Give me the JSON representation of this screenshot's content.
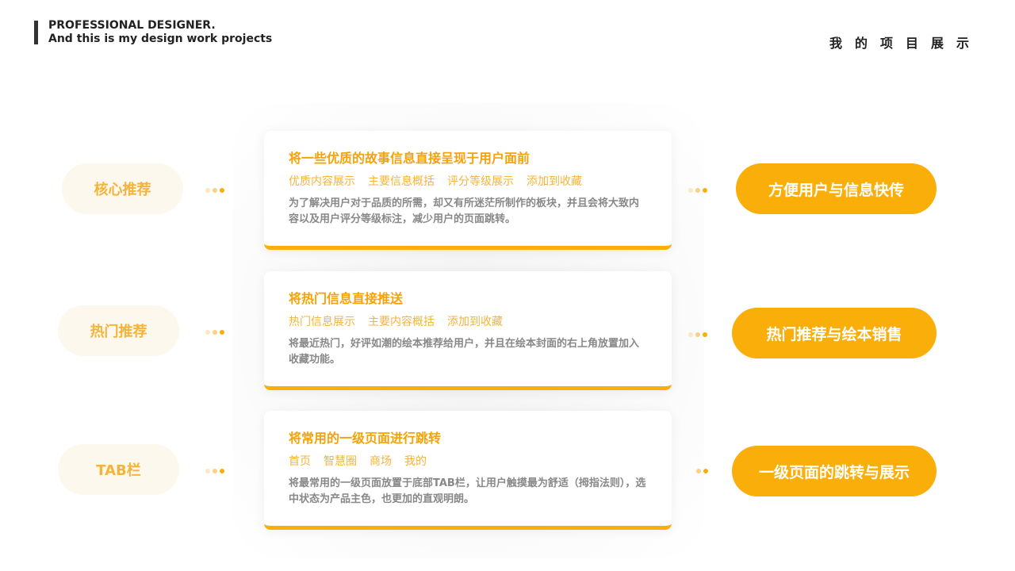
{
  "header": {
    "line1": "PROFESSIONAL DESIGNER.",
    "line2": "And this is my design work projects",
    "right_title": "我的项目展示"
  },
  "rows": [
    {
      "left_label": "核心推荐",
      "card_title": "将一些优质的故事信息直接呈现于用户面前",
      "tags": [
        "优质内容展示",
        "主要信息概括",
        "评分等级展示",
        "添加到收藏"
      ],
      "description": "为了解决用户对于品质的所需，却又有所迷茫所制作的板块，并且会将大致内容以及用户评分等级标注，减少用户的页面跳转。",
      "right_label": "方便用户与信息快传"
    },
    {
      "left_label": "热门推荐",
      "card_title": "将热门信息直接推送",
      "tags": [
        "热门信息展示",
        "主要内容概括",
        "添加到收藏"
      ],
      "description": "将最近热门，好评如潮的绘本推荐给用户，并且在绘本封面的右上角放置加入收藏功能。",
      "right_label": "热门推荐与绘本销售"
    },
    {
      "left_label": "TAB栏",
      "card_title": "将常用的一级页面进行跳转",
      "tags": [
        "首页",
        "智慧圈",
        "商场",
        "我的"
      ],
      "description": "将最常用的一级页面放置于底部TAB栏，让用户触摸最为舒适（拇指法则），选中状态为产品主色，也更加的直观明朗。",
      "right_label": "一级页面的跳转与展示"
    }
  ],
  "colors": {
    "accent": "#f9ae0a",
    "accent_text": "#f5a20a",
    "left_pill_bg": "#fdf8ed"
  }
}
